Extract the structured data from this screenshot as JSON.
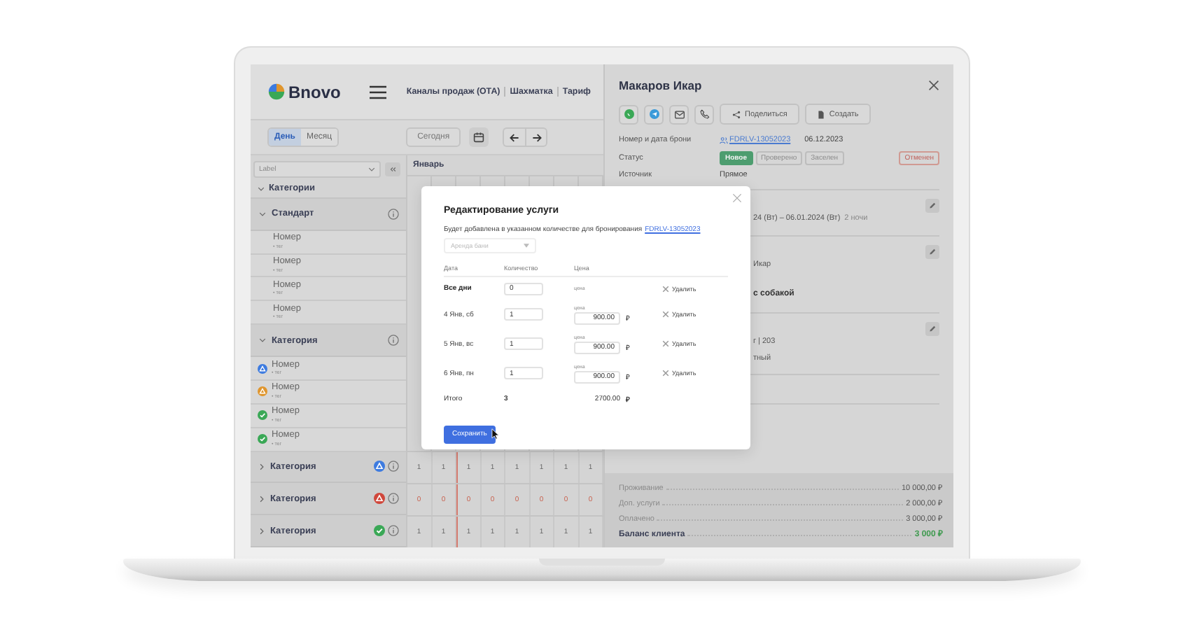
{
  "app": {
    "logo": "Bnovo",
    "nav": [
      "Каналы продаж (ОТА)",
      "Шахматка",
      "Тариф"
    ]
  },
  "toolbar": {
    "views": [
      {
        "label": "День",
        "selected": true
      },
      {
        "label": "Месяц",
        "selected": false
      }
    ],
    "today": "Сегодня"
  },
  "sidebar": {
    "placeholder": "Label",
    "heading": "Категории",
    "groups": [
      {
        "name": "Стандарт",
        "expanded": true,
        "rooms": [
          {
            "name": "Номер",
            "tag": "• тег"
          },
          {
            "name": "Номер",
            "tag": "• тег"
          },
          {
            "name": "Номер",
            "tag": "• тег"
          },
          {
            "name": "Номер",
            "tag": "• тег"
          }
        ]
      },
      {
        "name": "Категория",
        "expanded": true,
        "rooms": [
          {
            "name": "Номер",
            "tag": "• тег",
            "kind": "alert",
            "color": "#3d7be0"
          },
          {
            "name": "Номер",
            "tag": "• тег",
            "kind": "alert",
            "color": "#e0962e"
          },
          {
            "name": "Номер",
            "tag": "• тег",
            "kind": "check",
            "color": "#3aa856"
          },
          {
            "name": "Номер",
            "tag": "• тег",
            "kind": "check",
            "color": "#3aa856"
          }
        ]
      },
      {
        "name": "Категория",
        "expanded": false,
        "kind": "alert",
        "color": "#3d7be0"
      },
      {
        "name": "Категория",
        "expanded": false,
        "kind": "alert",
        "color": "#d0473b"
      },
      {
        "name": "Категория",
        "expanded": false,
        "kind": "check",
        "color": "#3aa856"
      }
    ]
  },
  "grid": {
    "month": "Январь",
    "columns": [
      {
        "today": false
      },
      {
        "today": false
      },
      {
        "today": true
      },
      {
        "today": false
      },
      {
        "today": false
      },
      {
        "today": false
      },
      {
        "today": false
      },
      {
        "today": false
      }
    ],
    "rows": [
      {
        "kind": "count",
        "values": [
          "1",
          "1",
          "1",
          "1",
          "1",
          "1",
          "1",
          "1"
        ]
      },
      {
        "kind": "alert",
        "values": [
          "0",
          "0",
          "0",
          "0",
          "0",
          "0",
          "0",
          "0"
        ]
      },
      {
        "kind": "count",
        "values": [
          "1",
          "1",
          "1",
          "1",
          "1",
          "1",
          "1",
          "1"
        ]
      }
    ]
  },
  "booking": {
    "guest": "Макаров Икар",
    "share": "Поделиться",
    "create": "Создать",
    "number_label": "Номер и дата брони",
    "number": "FDRLV-13052023",
    "date": "06.12.2023",
    "status_label": "Статус",
    "statuses": [
      {
        "label": "Новое",
        "selected": true,
        "kind": "normal"
      },
      {
        "label": "Проверено",
        "selected": false,
        "kind": "normal"
      },
      {
        "label": "Заселен",
        "selected": false,
        "kind": "normal"
      },
      {
        "label": "Отменен",
        "selected": false,
        "kind": "cancel"
      }
    ],
    "source_label": "Источник",
    "source": "Прямое",
    "sections": [
      {
        "editable": true,
        "lines": [
          {
            "kind": "plain",
            "text": "24 (Вт) – 06.01.2024 (Вт)",
            "note": "2 ночи"
          }
        ]
      },
      {
        "editable": true,
        "lines": [
          {
            "kind": "plain",
            "text": "Икар"
          },
          {
            "kind": "bold",
            "text": "с собакой"
          }
        ]
      },
      {
        "editable": true,
        "lines": [
          {
            "kind": "plain",
            "text": "г | 203"
          },
          {
            "kind": "plain",
            "text": "тный"
          }
        ]
      }
    ],
    "summary": [
      {
        "kind": "item",
        "label": "Проживание",
        "amount": "10 000,00 ₽"
      },
      {
        "kind": "item",
        "label": "Доп. услуги",
        "amount": "2 000,00 ₽"
      },
      {
        "kind": "item",
        "label": "Оплачено",
        "amount": "3 000,00 ₽"
      },
      {
        "kind": "total",
        "label": "Баланс клиента",
        "amount": "3 000 ₽"
      }
    ]
  },
  "modal": {
    "title": "Редактирование услуги",
    "note": "Будет добавлена в указанном количестве для бронирования",
    "link": "FDRLV-13052023",
    "service": "Аренда бани",
    "columns": [
      "Дата",
      "Количество",
      "Цена"
    ],
    "rows": [
      {
        "kind": "all",
        "date": "Все дни",
        "quantity": "0",
        "price_label": "цена",
        "remove": "Удалить"
      },
      {
        "kind": "day",
        "date": "4 Янв, сб",
        "quantity": "1",
        "price_label": "цена",
        "price": "900.00",
        "currency": "₽",
        "remove": "Удалить"
      },
      {
        "kind": "day",
        "date": "5 Янв, вс",
        "quantity": "1",
        "price_label": "цена",
        "price": "900.00",
        "currency": "₽",
        "remove": "Удалить"
      },
      {
        "kind": "day",
        "date": "6 Янв, пн",
        "quantity": "1",
        "price_label": "цена",
        "price": "900.00",
        "currency": "₽",
        "remove": "Удалить"
      }
    ],
    "total": {
      "label": "Итого",
      "quantity": "3",
      "price": "2700.00",
      "currency": "₽"
    },
    "save": "Сохранить"
  }
}
